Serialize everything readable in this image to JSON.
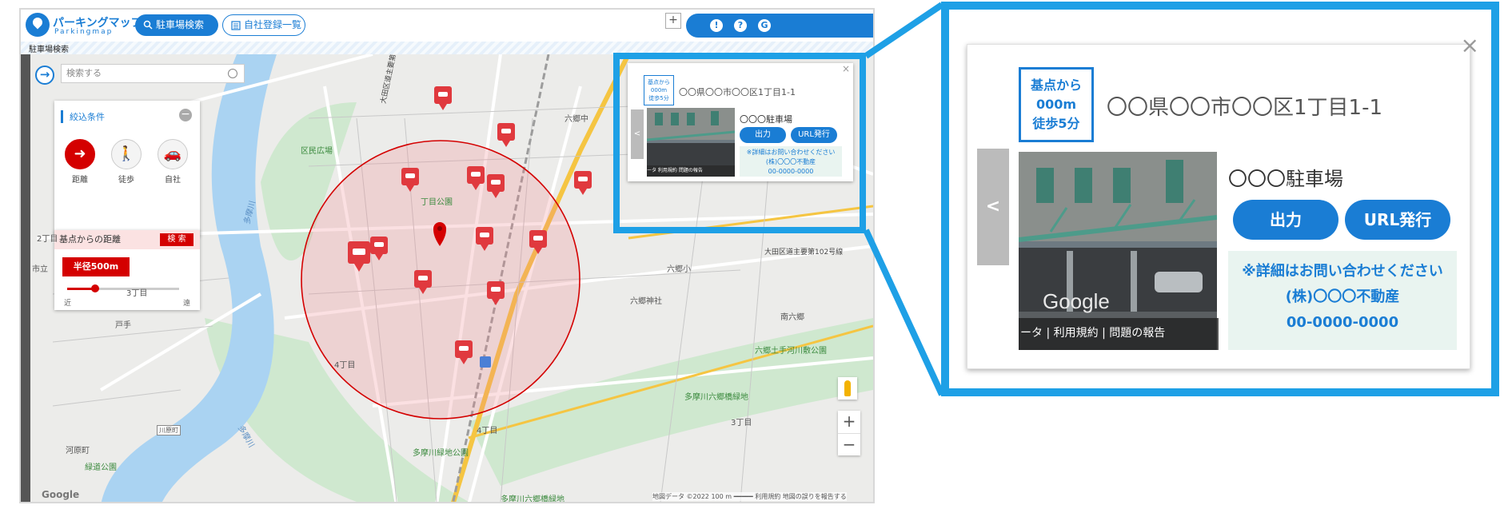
{
  "app": {
    "logo_name": "パーキングマップ",
    "logo_sub": "Parkingmap",
    "nav_search": "駐車場検索",
    "nav_company": "自社登録一覧",
    "plus": "+",
    "header_icons": [
      "!",
      "?",
      "G"
    ],
    "breadcrumb": "駐車場検索"
  },
  "map": {
    "search_placeholder": "検索する",
    "filter": {
      "title": "絞込条件",
      "modes": [
        {
          "label": "距離",
          "icon": "car-curve-icon",
          "active": true
        },
        {
          "label": "徒歩",
          "icon": "walk-icon",
          "active": false
        },
        {
          "label": "自社",
          "icon": "car-icon",
          "active": false
        }
      ]
    },
    "distance": {
      "header": "基点からの距離",
      "go": "検 索",
      "radius": "半径500m",
      "near": "近",
      "far": "遠",
      "slider_fraction": 0.25
    },
    "labels": [
      "六郷中",
      "区民広場",
      "大田区道主要第102号線",
      "丁目公園",
      "六郷小",
      "六郷神社",
      "南六郷",
      "六郷土手河川敷公園",
      "大田区道主要第102号線",
      "多摩川六郷橋緑地",
      "3丁目",
      "4丁目",
      "4丁目",
      "河原町",
      "緑道公園",
      "多摩川緑地公園",
      "戸手",
      "市立",
      "2丁目",
      "3丁目",
      "多摩川",
      "多摩川",
      "川原町",
      "多摩川六郷橋緑地"
    ],
    "google": "Google",
    "attribution": "地図データ ©2022   100 m ━━━━━   利用規約   地図の誤りを報告する",
    "zoom_in": "+",
    "zoom_out": "−"
  },
  "info": {
    "badge_line1": "基点から",
    "badge_line2": "000m",
    "badge_line3": "徒歩5分",
    "address": "〇〇県〇〇市〇〇区1丁目1-1",
    "parking_name": "〇〇〇駐車場",
    "btn_output": "出力",
    "btn_url": "URL発行",
    "contact_line1": "※詳細はお問い合わせください",
    "contact_line2": "(株)〇〇〇不動産",
    "contact_line3": "00-0000-0000",
    "photo_caption_small": "ータ  利用規約  問題の報告",
    "photo_caption_big": "ータ | 利用規約 | 問題の報告",
    "photo_google": "Google",
    "tab_arrow": "<",
    "close": "×"
  },
  "colors": {
    "brand_blue": "#1a7dd4",
    "callout_blue": "#1ea0e6",
    "pin_red": "#e0393e",
    "radius_red": "#d40000"
  }
}
